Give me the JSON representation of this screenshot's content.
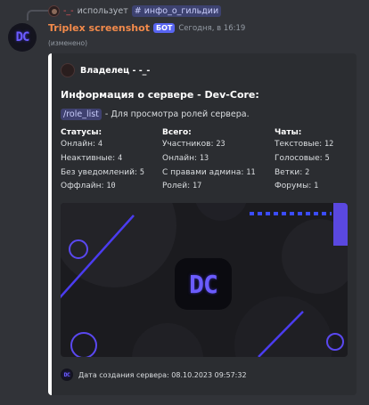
{
  "reply": {
    "username": "-_-",
    "verb": "использует",
    "command": "# инфо_о_гильдии"
  },
  "message": {
    "author": "Triplex screenshot",
    "bot_tag": "БОТ",
    "timestamp": "Сегодня, в 16:19",
    "edited": "(изменено)"
  },
  "embed": {
    "border_color": "#ffffff",
    "author": "Владелец - -_-",
    "title": "Информация о сервере - Dev-Core:",
    "command": "/role_list",
    "description": "- Для просмотра ролей сервера.",
    "fields": [
      {
        "name": "Статусы:",
        "lines": [
          {
            "label": "Онлайн:",
            "value": "4"
          },
          {
            "label": "Неактивные:",
            "value": "4"
          },
          {
            "label": "Без уведомлений:",
            "value": "5"
          },
          {
            "label": "Оффлайн:",
            "value": "10"
          }
        ]
      },
      {
        "name": "Всего:",
        "lines": [
          {
            "label": "Участников:",
            "value": "23"
          },
          {
            "label": "Онлайн:",
            "value": "13"
          },
          {
            "label": "С правами админа:",
            "value": "11"
          },
          {
            "label": "Ролей:",
            "value": "17"
          }
        ]
      },
      {
        "name": "Чаты:",
        "lines": [
          {
            "label": "Текстовые:",
            "value": "12"
          },
          {
            "label": "Голосовые:",
            "value": "5"
          },
          {
            "label": "Ветки:",
            "value": "2"
          },
          {
            "label": "Форумы:",
            "value": "1"
          }
        ]
      }
    ],
    "banner_logo": "DC",
    "footer": "Дата создания сервера: 08.10.2023 09:57:32"
  },
  "avatar_logo": "DC",
  "footer_logo": "DC",
  "colors": {
    "background": "#313338",
    "embed_background": "#2b2d31",
    "author_name": "#f28a4b",
    "bot_tag": "#5865f2",
    "accent_purple": "#6b5cff",
    "reply_name": "#e0525a"
  },
  "icons": {
    "reply_avatar": "user-avatar",
    "bot_avatar": "dev-core-logo",
    "owner_avatar": "user-avatar",
    "footer_icon": "dev-core-logo"
  }
}
